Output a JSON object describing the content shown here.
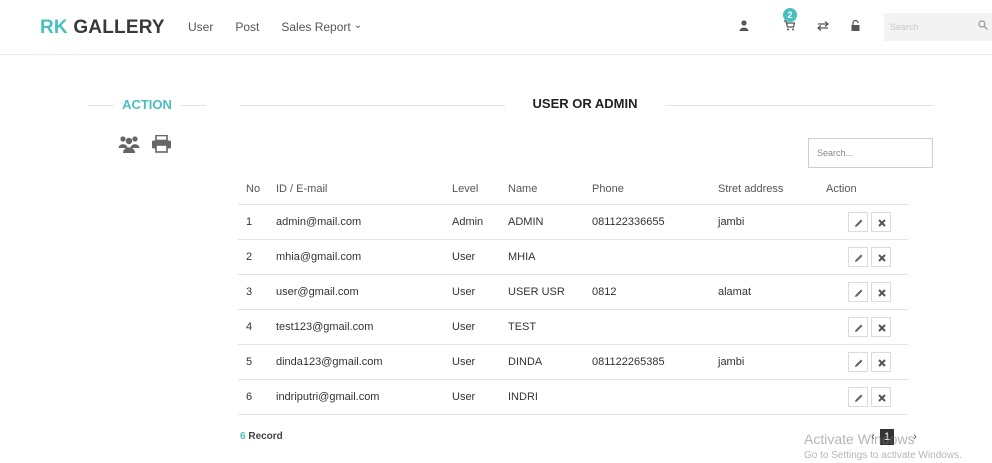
{
  "brand": {
    "accent": "RK",
    "rest": " GALLERY"
  },
  "nav": {
    "items": [
      "User",
      "Post",
      "Sales Report"
    ]
  },
  "header": {
    "cart_count": "2",
    "search_placeholder": "Search"
  },
  "icons": {
    "user": "user-icon",
    "cart": "cart-icon",
    "transfer": "transfer-icon",
    "lock": "unlock-icon",
    "search": "search-icon"
  },
  "sidebar": {
    "title": "ACTION"
  },
  "main": {
    "title": "USER OR ADMIN",
    "search_placeholder": "Search..."
  },
  "table": {
    "columns": [
      "No",
      "ID / E-mail",
      "Level",
      "Name",
      "Phone",
      "Stret address",
      "Action"
    ],
    "rows": [
      [
        "1",
        "admin@mail.com",
        "Admin",
        "ADMIN",
        "081122336655",
        "jambi"
      ],
      [
        "2",
        "mhia@gmail.com",
        "User",
        "MHIA",
        "",
        ""
      ],
      [
        "3",
        "user@gmail.com",
        "User",
        "USER USR",
        "0812",
        "alamat"
      ],
      [
        "4",
        "test123@gmail.com",
        "User",
        "TEST",
        "",
        ""
      ],
      [
        "5",
        "dinda123@gmail.com",
        "User",
        "DINDA",
        "081122265385",
        "jambi"
      ],
      [
        "6",
        "indriputri@gmail.com",
        "User",
        "INDRI",
        "",
        ""
      ]
    ]
  },
  "footer": {
    "record_count": "6",
    "record_label": " Record",
    "pager": {
      "prev": "‹",
      "current": "1",
      "next": "›"
    }
  },
  "watermark": {
    "line1": "Activate Windows",
    "line2": "Go to Settings to activate Windows."
  },
  "colors": {
    "accent": "#49c0c0",
    "text": "#333333"
  }
}
